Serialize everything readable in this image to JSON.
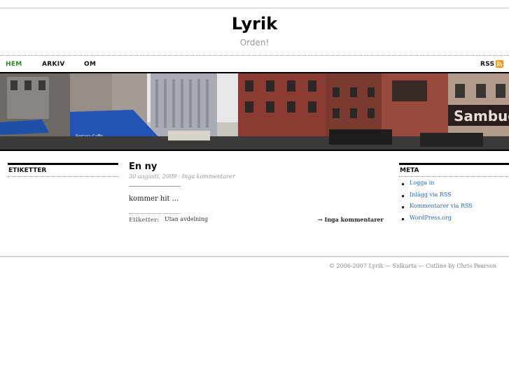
{
  "site": {
    "title": "Lyrik",
    "description": "Orden!"
  },
  "nav": {
    "items": [
      {
        "label": "HEM",
        "active": true
      },
      {
        "label": "ARKIV",
        "active": false
      },
      {
        "label": "OM",
        "active": false
      }
    ],
    "rss_label": "RSS",
    "active_color": "#2c8a2c"
  },
  "header_image": {
    "alt": "city street panorama",
    "texts": [
      "Ferrara Caffe",
      "Sambuca"
    ]
  },
  "left_sidebar": {
    "heading": "ETIKETTER"
  },
  "post": {
    "title": "En ny",
    "date": "30 augusti, 2009",
    "meta_separator": "·",
    "comments_meta": "Inga kommentarer",
    "body": "kommer hit ...",
    "tags_label": "Etiketter:",
    "tags_value": "Utan avdelning",
    "comments_link": "→ Inga kommentarer"
  },
  "right_sidebar": {
    "heading": "META",
    "items": [
      "Logga in",
      "Inlägg via RSS",
      "Kommentarer via RSS",
      "WordPress.org"
    ]
  },
  "footer": {
    "text": "© 2006-2007 Lyrik — Sidkarta — Cutline by Chris Pearson"
  },
  "colors": {
    "link": "#2a6bb0",
    "rss": "#f49b1f"
  }
}
